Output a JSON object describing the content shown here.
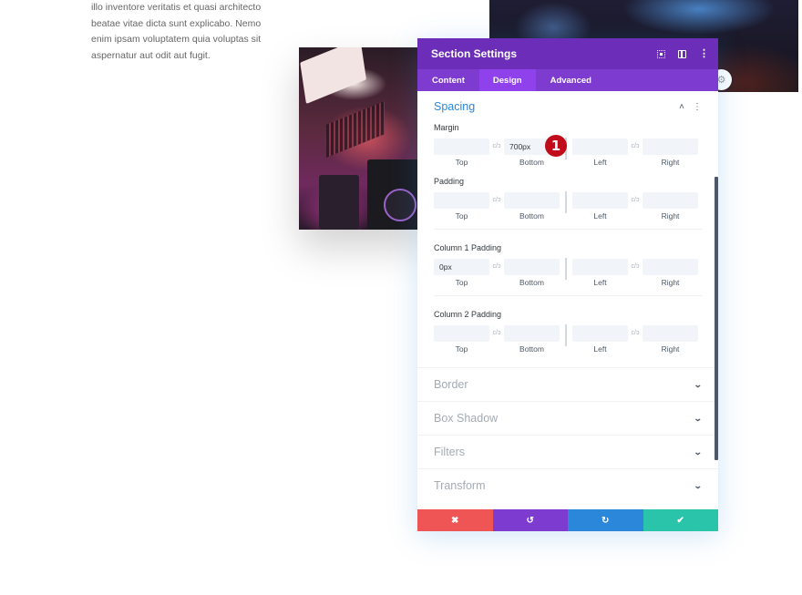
{
  "page": {
    "body_text_lines": [
      "illo inventore veritatis et quasi architecto",
      "beatae vitae dicta sunt explicabo. Nemo",
      "enim ipsam voluptatem quia voluptas sit",
      "aspernatur aut odit aut fugit."
    ],
    "hero_badge_icon": "⚙"
  },
  "modal": {
    "title": "Section Settings",
    "header_icons": [
      "expand-icon",
      "columns-icon",
      "kebab-icon"
    ],
    "tabs": [
      {
        "label": "Content",
        "active": false
      },
      {
        "label": "Design",
        "active": true
      },
      {
        "label": "Advanced",
        "active": false
      }
    ],
    "spacing": {
      "title": "Spacing",
      "chevron": "˄",
      "kebab": "⋮",
      "link_glyph": "✐",
      "sides": [
        "Top",
        "Bottom",
        "Left",
        "Right"
      ],
      "groups": [
        {
          "label": "Margin",
          "values": [
            "",
            "700px",
            "",
            ""
          ]
        },
        {
          "label": "Padding",
          "values": [
            "",
            "",
            "",
            ""
          ]
        },
        {
          "label": "Column 1 Padding",
          "values": [
            "0px",
            "",
            "",
            ""
          ]
        },
        {
          "label": "Column 2 Padding",
          "values": [
            "",
            "",
            "",
            ""
          ]
        }
      ]
    },
    "annotation_badge": "1",
    "collapsed_sections": [
      "Border",
      "Box Shadow",
      "Filters",
      "Transform"
    ],
    "chevron_down": "⌄",
    "footer": {
      "buttons": [
        {
          "name": "cancel",
          "glyph": "✖",
          "color": "#ef5555"
        },
        {
          "name": "undo",
          "glyph": "↺",
          "color": "#7e3bd0"
        },
        {
          "name": "redo",
          "glyph": "↻",
          "color": "#2b87da"
        },
        {
          "name": "save",
          "glyph": "✔",
          "color": "#29c4a9"
        }
      ]
    }
  },
  "colors": {
    "header": "#6c2eb9",
    "tabs_bar": "#7d3bcf",
    "tab_active": "#8f42ec",
    "accent_blue": "#2b87da",
    "badge_red": "#c10d1b"
  }
}
